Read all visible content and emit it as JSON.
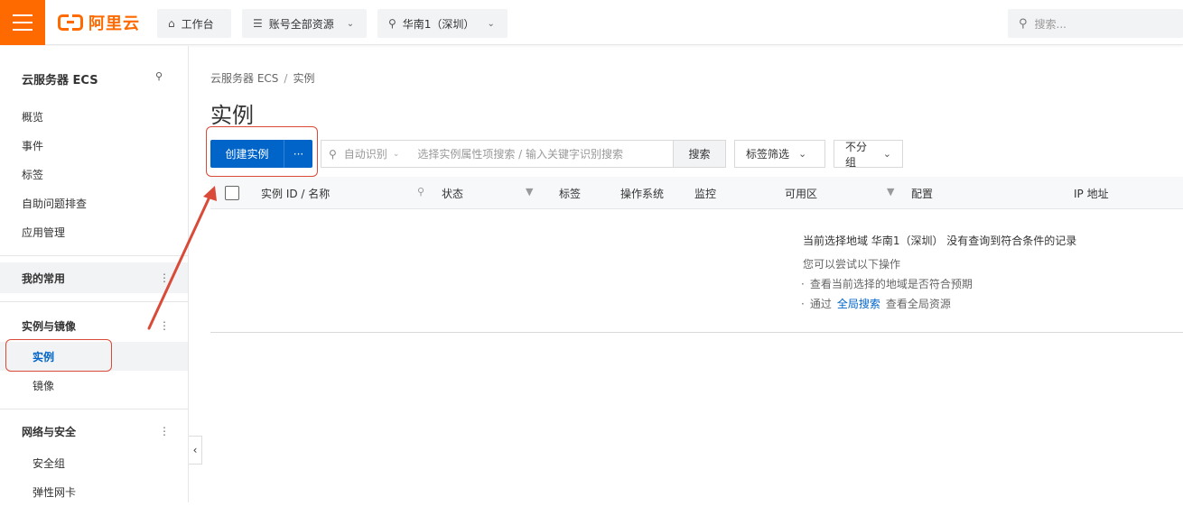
{
  "topbar": {
    "logo_text": "阿里云",
    "workbench": "工作台",
    "resources": "账号全部资源",
    "region": "华南1（深圳）",
    "search_placeholder": "搜索..."
  },
  "sidebar": {
    "title": "云服务器 ECS",
    "top_items": [
      "概览",
      "事件",
      "标签",
      "自助问题排查",
      "应用管理"
    ],
    "group_favorites": "我的常用",
    "group_instances": "实例与镜像",
    "instances_items": [
      "实例",
      "镜像"
    ],
    "group_network": "网络与安全",
    "network_items": [
      "安全组",
      "弹性网卡"
    ]
  },
  "breadcrumb": {
    "parent": "云服务器 ECS",
    "sep": "/",
    "current": "实例"
  },
  "page_title": "实例",
  "toolbar": {
    "create_label": "创建实例",
    "more_label": "···",
    "auto_detect": "自动识别",
    "search_placeholder": "选择实例属性项搜索 / 输入关键字识别搜索",
    "search_button": "搜索",
    "tag_filter": "标签筛选",
    "no_group": "不分组"
  },
  "table": {
    "columns": [
      "实例 ID / 名称",
      "状态",
      "标签",
      "操作系统",
      "监控",
      "可用区",
      "配置",
      "IP 地址"
    ]
  },
  "empty": {
    "title": "当前选择地域 华南1（深圳） 没有查询到符合条件的记录",
    "subtitle": "您可以尝试以下操作",
    "tip1": "查看当前选择的地域是否符合预期",
    "tip2_prefix": "通过",
    "tip2_link": "全局搜索",
    "tip2_suffix": "查看全局资源"
  },
  "colors": {
    "brand": "#ff6a00",
    "primary": "#0064c8",
    "annotation": "#d94a38"
  }
}
